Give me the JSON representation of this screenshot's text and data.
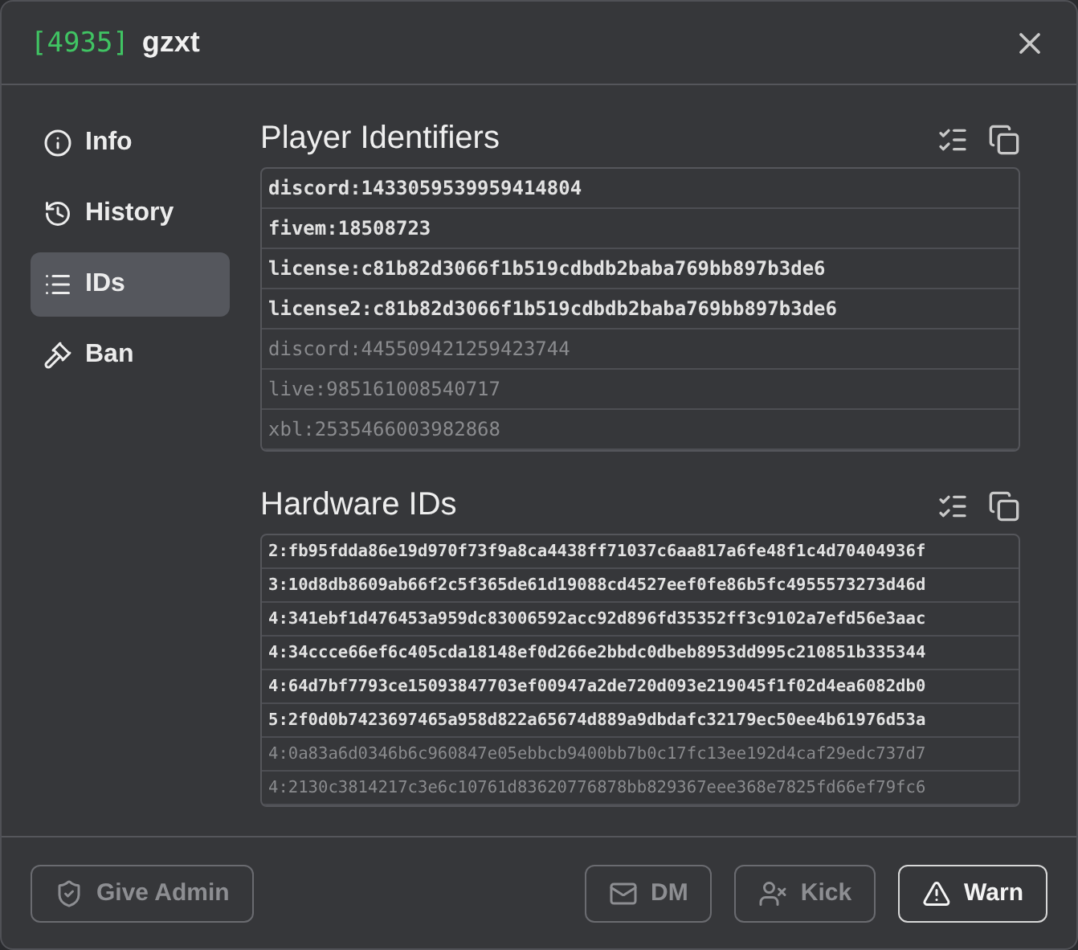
{
  "window": {
    "id_tag": "[4935]",
    "title": "gzxt"
  },
  "sidebar": {
    "items": [
      {
        "label": "Info",
        "kind": "info",
        "selected": false
      },
      {
        "label": "History",
        "kind": "history",
        "selected": false
      },
      {
        "label": "IDs",
        "kind": "list",
        "selected": true
      },
      {
        "label": "Ban",
        "kind": "gavel",
        "selected": false
      }
    ]
  },
  "sections": [
    {
      "title": "Player Identifiers",
      "kind": "player",
      "rows": [
        {
          "text": "discord:1433059539959414804",
          "active": true
        },
        {
          "text": "fivem:18508723",
          "active": true
        },
        {
          "text": "license:c81b82d3066f1b519cdbdb2baba769bb897b3de6",
          "active": true
        },
        {
          "text": "license2:c81b82d3066f1b519cdbdb2baba769bb897b3de6",
          "active": true
        },
        {
          "text": "discord:445509421259423744",
          "active": false
        },
        {
          "text": "live:985161008540717",
          "active": false
        },
        {
          "text": "xbl:2535466003982868",
          "active": false
        }
      ]
    },
    {
      "title": "Hardware IDs",
      "kind": "hardware",
      "rows": [
        {
          "text": "2:fb95fdda86e19d970f73f9a8ca4438ff71037c6aa817a6fe48f1c4d70404936f",
          "active": true
        },
        {
          "text": "3:10d8db8609ab66f2c5f365de61d19088cd4527eef0fe86b5fc4955573273d46d",
          "active": true
        },
        {
          "text": "4:341ebf1d476453a959dc83006592acc92d896fd35352ff3c9102a7efd56e3aac",
          "active": true
        },
        {
          "text": "4:34ccce66ef6c405cda18148ef0d266e2bbdc0dbeb8953dd995c210851b335344",
          "active": true
        },
        {
          "text": "4:64d7bf7793ce15093847703ef00947a2de720d093e219045f1f02d4ea6082db0",
          "active": true
        },
        {
          "text": "5:2f0d0b7423697465a958d822a65674d889a9dbdafc32179ec50ee4b61976d53a",
          "active": true
        },
        {
          "text": "4:0a83a6d0346b6c960847e05ebbcb9400bb7b0c17fc13ee192d4caf29edc737d7",
          "active": false
        },
        {
          "text": "4:2130c3814217c3e6c10761d83620776878bb829367eee368e7825fd66ef79fc6",
          "active": false
        }
      ]
    }
  ],
  "footer": {
    "left_buttons": [
      {
        "label": "Give Admin",
        "kind": "shield",
        "disabled": true
      }
    ],
    "right_buttons": [
      {
        "label": "DM",
        "kind": "mail",
        "disabled": true
      },
      {
        "label": "Kick",
        "kind": "kick",
        "disabled": true
      },
      {
        "label": "Warn",
        "kind": "warning",
        "disabled": false
      }
    ]
  }
}
